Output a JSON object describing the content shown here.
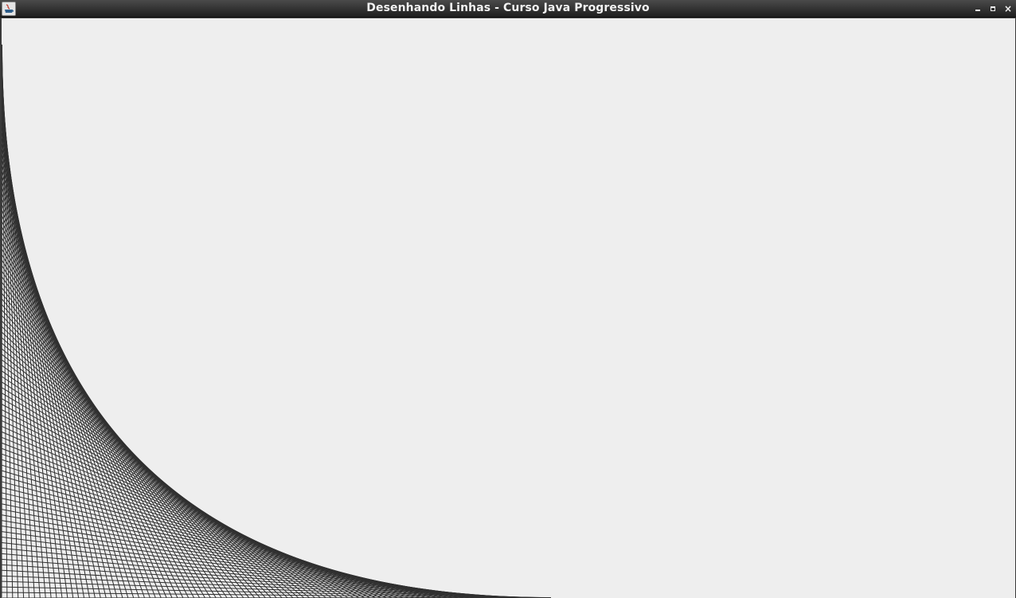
{
  "window": {
    "title": "Desenhando Linhas - Curso Java Progressivo",
    "icon": "java-app-icon",
    "controls": {
      "minimize_icon": "minimize-icon",
      "maximize_icon": "maximize-icon",
      "close_icon": "close-icon",
      "close_glyph": "×"
    }
  },
  "canvas": {
    "background": "#eeeeee",
    "line_color": "#303030"
  }
}
